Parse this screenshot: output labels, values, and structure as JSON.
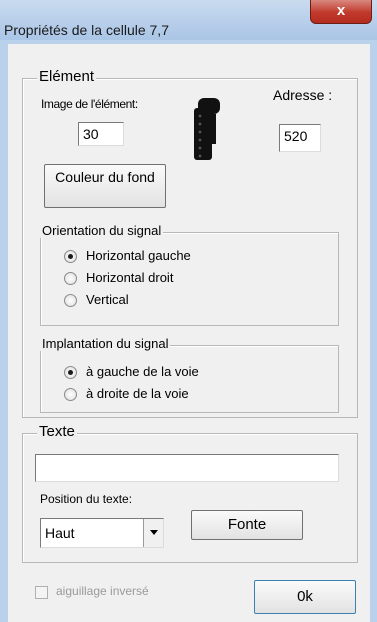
{
  "window": {
    "title": "Propriétés de la cellule 7,7",
    "close_label": "x"
  },
  "element": {
    "legend": "Elément",
    "image_label": "Image de l'élément:",
    "image_value": "30",
    "address_label": "Adresse :",
    "address_value": "520",
    "bg_color_button": "Couleur du fond",
    "element_icon": "signal-icon"
  },
  "orientation": {
    "legend": "Orientation du signal",
    "options": [
      "Horizontal gauche",
      "Horizontal droit",
      "Vertical"
    ],
    "selected": "Horizontal gauche"
  },
  "implantation": {
    "legend": "Implantation du signal",
    "options": [
      "à gauche de la voie",
      "à droite de la voie"
    ],
    "selected": "à gauche de la voie"
  },
  "texte": {
    "legend": "Texte",
    "value": "",
    "position_label": "Position du texte:",
    "position_value": "Haut",
    "font_button": "Fonte"
  },
  "footer": {
    "checkbox_label": "aiguillage inversé",
    "checkbox_checked": false,
    "ok_button": "0k"
  },
  "colors": {
    "frame": "#b9d1ea",
    "client": "#f0f0f0",
    "close": "#c0392b"
  }
}
